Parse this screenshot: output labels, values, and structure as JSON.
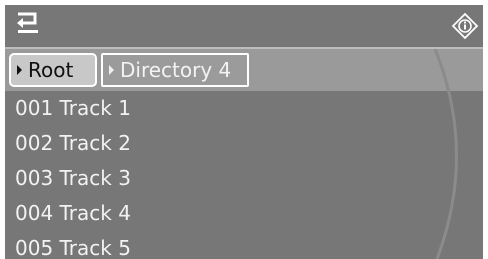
{
  "header": {
    "back_icon": "back-arrow-icon",
    "info_icon": "info-icon"
  },
  "breadcrumb": {
    "root_label": "Root",
    "current_label": "Directory 4"
  },
  "tracks": [
    {
      "label": "001 Track 1"
    },
    {
      "label": "002 Track 2"
    },
    {
      "label": "003 Track 3"
    },
    {
      "label": "004 Track 4"
    },
    {
      "label": "005 Track 5"
    }
  ],
  "colors": {
    "background": "#7b7b7b",
    "breadcrumb_bar": "#9a9a9a",
    "root_crumb": "#c8c8c8",
    "text_light": "#f2f2f2",
    "text_dark": "#101010"
  }
}
